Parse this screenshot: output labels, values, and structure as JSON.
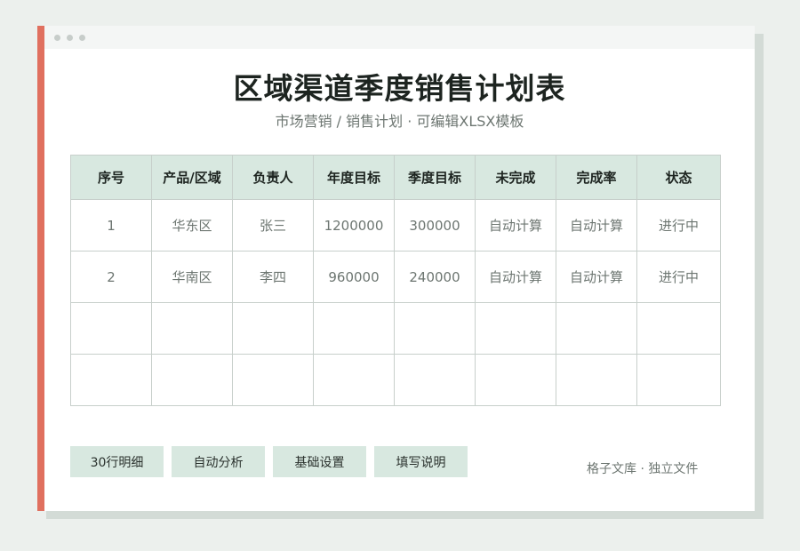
{
  "title": "区域渠道季度销售计划表",
  "subtitle": "市场营销 / 销售计划 · 可编辑XLSX模板",
  "table": {
    "headers": [
      "序号",
      "产品/区域",
      "负责人",
      "年度目标",
      "季度目标",
      "未完成",
      "完成率",
      "状态"
    ],
    "rows": [
      [
        "1",
        "华东区",
        "张三",
        "1200000",
        "300000",
        "自动计算",
        "自动计算",
        "进行中"
      ],
      [
        "2",
        "华南区",
        "李四",
        "960000",
        "240000",
        "自动计算",
        "自动计算",
        "进行中"
      ],
      [
        "",
        "",
        "",
        "",
        "",
        "",
        "",
        ""
      ],
      [
        "",
        "",
        "",
        "",
        "",
        "",
        "",
        ""
      ]
    ]
  },
  "buttons": [
    "30行明细",
    "自动分析",
    "基础设置",
    "填写说明"
  ],
  "footer": "格子文库 · 独立文件",
  "colors": {
    "accent": "#e0705f",
    "header_fill": "#d8e8e0",
    "background": "#ecf0ed"
  }
}
